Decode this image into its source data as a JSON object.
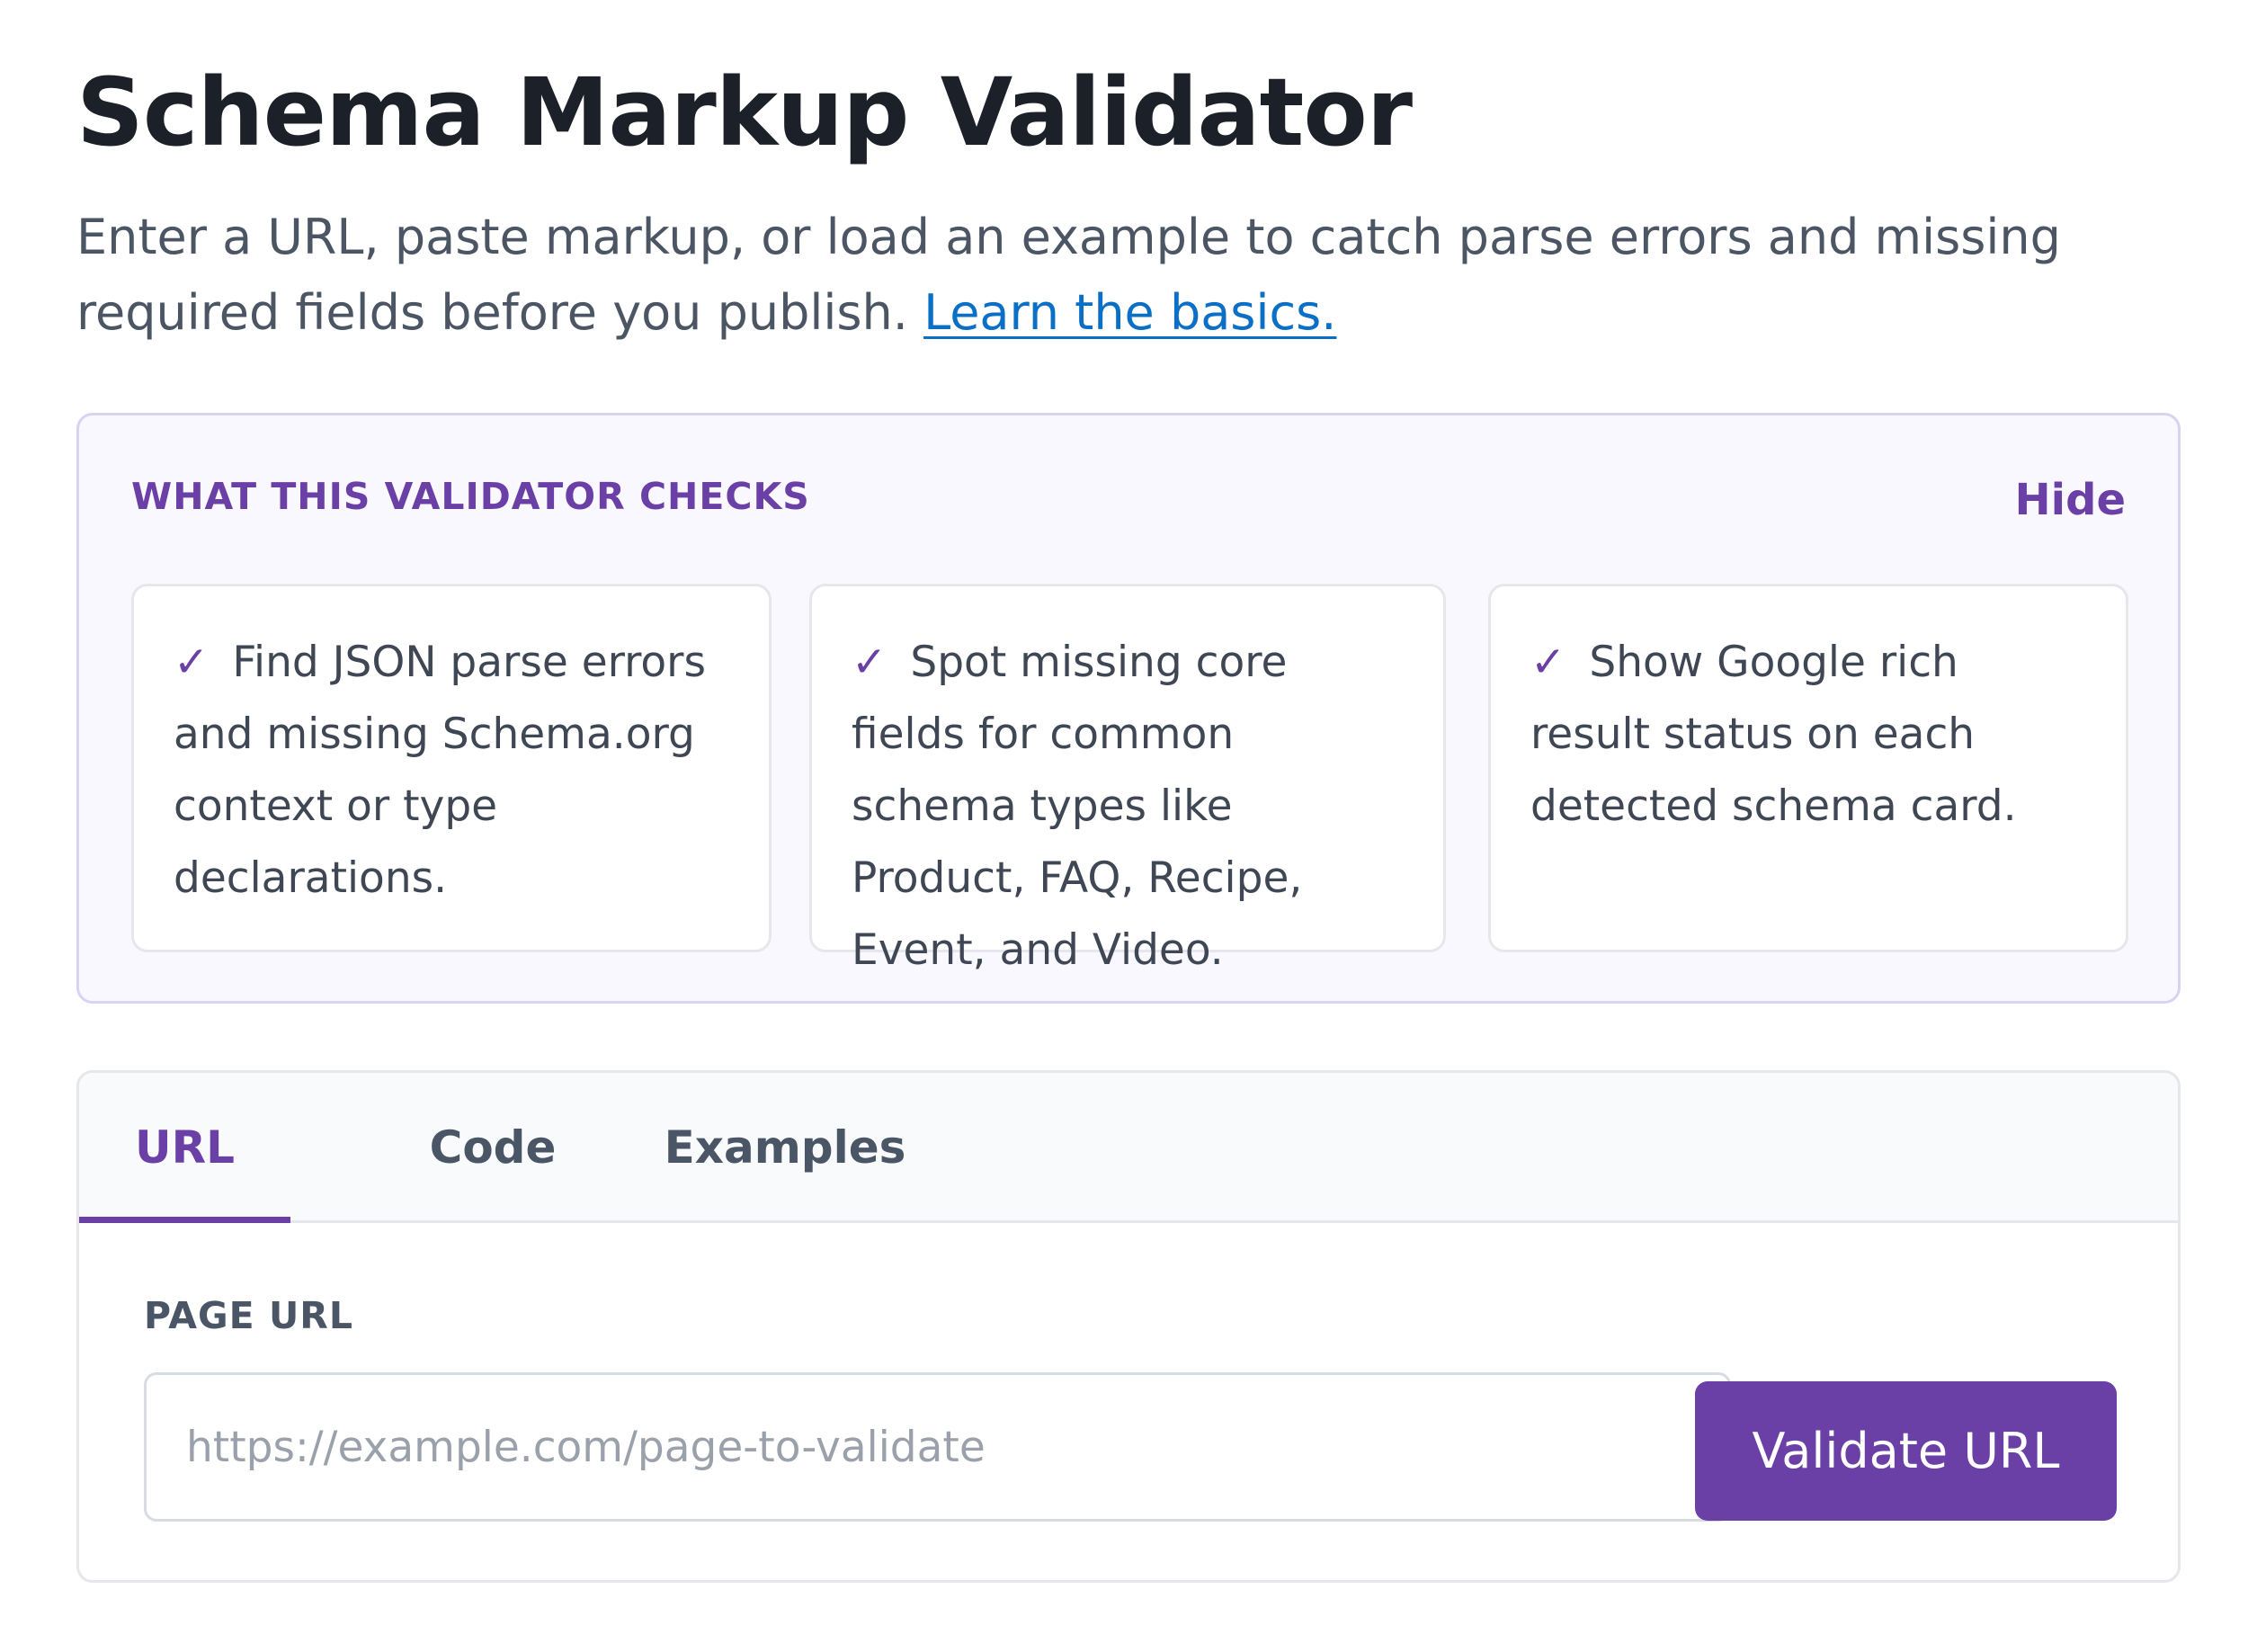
{
  "page": {
    "title": "Schema Markup Validator",
    "intro_text": "Enter a URL, paste markup, or load an example to catch parse errors and missing required fields before you publish.",
    "learn_link": "Learn the basics."
  },
  "checks": {
    "heading": "WHAT THIS VALIDATOR CHECKS",
    "hide_label": "Hide",
    "check_mark": "✓",
    "items": [
      {
        "text": "Find JSON parse errors and missing Schema.org context or type declarations."
      },
      {
        "text": "Spot missing core fields for common schema types like Product, FAQ, Recipe, Event, and Video."
      },
      {
        "text": "Show Google rich result status on each detected schema card."
      }
    ]
  },
  "validator": {
    "tabs": [
      {
        "label": "URL",
        "active": true
      },
      {
        "label": "Code",
        "active": false
      },
      {
        "label": "Examples",
        "active": false
      }
    ],
    "field_label": "PAGE URL",
    "input_value": "",
    "input_placeholder": "https://example.com/page-to-validate",
    "submit_label": "Validate URL"
  },
  "colors": {
    "accent": "#6a3fa6",
    "link": "#0b6fc6",
    "panel_background": "#f9f8fe",
    "panel_border": "#d9d2f3",
    "tab_bar_background": "#f8fafc",
    "text_primary": "#1c2028",
    "text_secondary": "#4b5563"
  },
  "icons": {
    "check": "check-icon"
  }
}
